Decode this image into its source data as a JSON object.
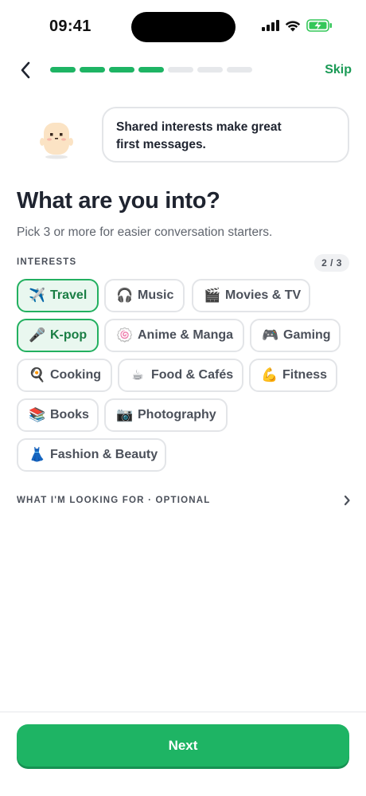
{
  "status": {
    "time": "09:41",
    "icons": [
      "cellular-signal-icon",
      "wifi-icon",
      "battery-charging-icon"
    ],
    "battery_color": "#34c759"
  },
  "nav": {
    "back_icon": "chevron-left-icon",
    "progress_total": 7,
    "progress_done": 4,
    "skip_label": "Skip"
  },
  "bubble": {
    "mascot_icon": "mascot-character-icon",
    "line1": "Shared interests make great",
    "line2": "first messages."
  },
  "heading": {
    "title": "What are you into?",
    "subtitle": "Pick 3 or more for easier conversation starters."
  },
  "interests": {
    "label": "INTERESTS",
    "count": "2 / 3",
    "chips": [
      {
        "emoji": "✈️",
        "label": "Travel",
        "selected": true
      },
      {
        "emoji": "🎧",
        "label": "Music",
        "selected": false
      },
      {
        "emoji": "🎬",
        "label": "Movies & TV",
        "selected": false
      },
      {
        "emoji": "🎤",
        "label": "K-pop",
        "selected": true
      },
      {
        "emoji": "🍥",
        "label": "Anime & Manga",
        "selected": false
      },
      {
        "emoji": "🎮",
        "label": "Gaming",
        "selected": false
      },
      {
        "emoji": "🍳",
        "label": "Cooking",
        "selected": false
      },
      {
        "emoji": "☕",
        "label": "Food & Cafés",
        "selected": false
      },
      {
        "emoji": "💪",
        "label": "Fitness",
        "selected": false
      },
      {
        "emoji": "📚",
        "label": "Books",
        "selected": false
      },
      {
        "emoji": "📷",
        "label": "Photography",
        "selected": false
      },
      {
        "emoji": "👗",
        "label": "Fashion & Beauty",
        "selected": false
      }
    ]
  },
  "looking_for": {
    "label": "WHAT I'M LOOKING FOR · OPTIONAL",
    "chevron_icon": "chevron-right-icon"
  },
  "footer": {
    "next_label": "Next"
  },
  "colors": {
    "accent": "#1eb464",
    "accent_text": "#1a9a55",
    "selected_bg": "#e9f7ef"
  }
}
